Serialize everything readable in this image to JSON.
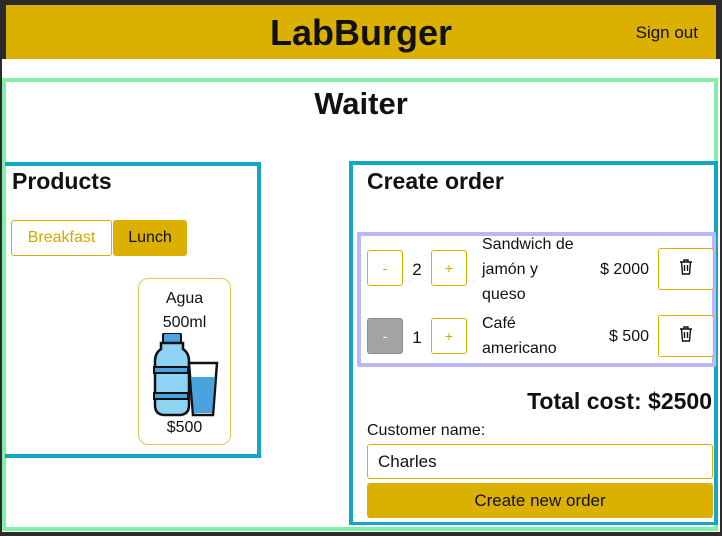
{
  "header": {
    "brand": "LabBurger",
    "signout_label": "Sign out"
  },
  "page": {
    "title": "Waiter"
  },
  "products": {
    "title": "Products",
    "tabs": [
      {
        "label": "Breakfast",
        "active": false
      },
      {
        "label": "Lunch",
        "active": true
      }
    ],
    "items": [
      {
        "name_line1": "Agua",
        "name_line2": "500ml",
        "icon": "water-bottle-glass-icon",
        "price": "$500"
      }
    ]
  },
  "order": {
    "title": "Create order",
    "items": [
      {
        "minus": "-",
        "qty": "2",
        "plus": "+",
        "name_lines": [
          "Sandwich de",
          "jamón y",
          "queso"
        ],
        "price": "$ 2000",
        "minus_disabled": false
      },
      {
        "minus": "-",
        "qty": "1",
        "plus": "+",
        "name_lines": [
          "Café",
          "americano"
        ],
        "price": "$ 500",
        "minus_disabled": true
      }
    ],
    "total": "Total cost: $2500",
    "customer_label": "Customer name:",
    "customer_value": "Charles",
    "create_label": "Create new order"
  },
  "colors": {
    "brand": "#dbb000",
    "panel_border": "#13a6c6",
    "page_border": "#80f0a6",
    "items_border": "#b9b7f7"
  }
}
